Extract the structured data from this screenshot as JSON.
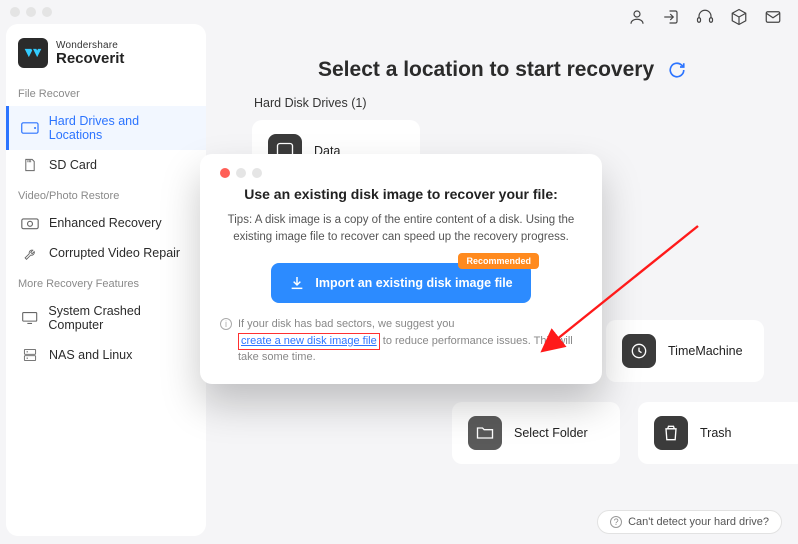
{
  "brand": {
    "line1": "Wondershare",
    "line2": "Recoverit"
  },
  "header_icons": [
    "user",
    "login",
    "headset",
    "cube",
    "mail"
  ],
  "sections": {
    "file_recover": {
      "title": "File Recover",
      "items": [
        {
          "label": "Hard Drives and Locations",
          "icon": "hdd",
          "active": true
        },
        {
          "label": "SD Card",
          "icon": "sdcard",
          "active": false
        }
      ]
    },
    "video_photo": {
      "title": "Video/Photo Restore",
      "items": [
        {
          "label": "Enhanced Recovery",
          "icon": "camera"
        },
        {
          "label": "Corrupted Video Repair",
          "icon": "wrench"
        }
      ]
    },
    "more": {
      "title": "More Recovery Features",
      "items": [
        {
          "label": "System Crashed Computer",
          "icon": "pc"
        },
        {
          "label": "NAS and Linux",
          "icon": "nas"
        }
      ]
    }
  },
  "main": {
    "title": "Select a location to start recovery",
    "drives_header": "Hard Disk Drives (1)",
    "peek_drive": "Data",
    "timemachine": "TimeMachine",
    "select_folder": "Select Folder",
    "trash": "Trash"
  },
  "modal": {
    "title": "Use an existing disk image to recover your file:",
    "tip": "Tips: A disk image is a copy of the entire content of a disk. Using the existing image file to recover can speed up the recovery progress.",
    "import_label": "Import an existing disk image file",
    "badge": "Recommended",
    "note_pre": "If your disk has bad sectors, we suggest you ",
    "note_link": "create a new disk image file",
    "note_post": " to reduce performance issues. This will take some time."
  },
  "footer": {
    "detect": "Can't detect your hard drive?"
  }
}
